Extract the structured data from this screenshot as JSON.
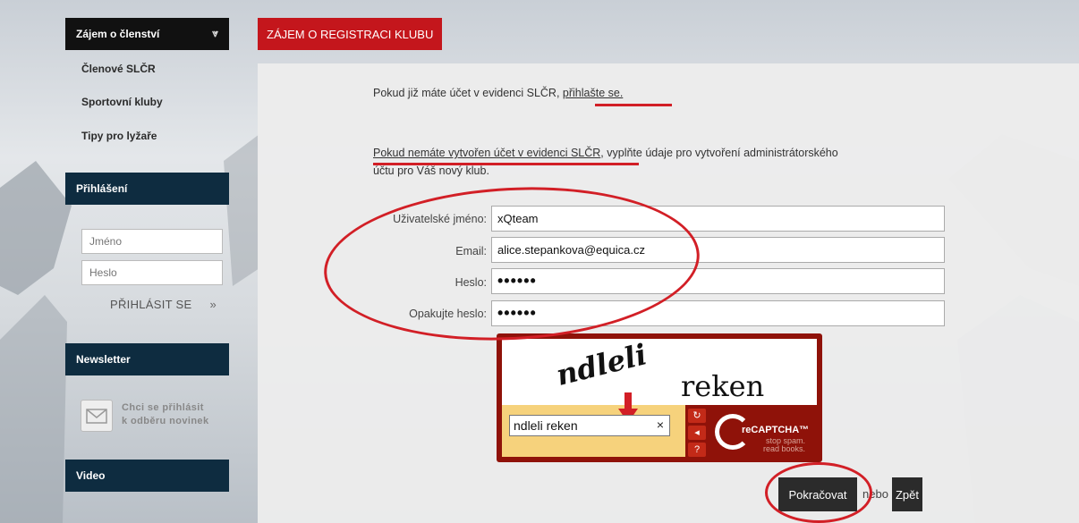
{
  "sidebar": {
    "top_header": "Zájem o členství",
    "links": [
      "Členové SLČR",
      "Sportovní kluby",
      "Tipy pro lyžaře"
    ],
    "login_header": "Přihlášení",
    "login_name_placeholder": "Jméno",
    "login_password_placeholder": "Heslo",
    "login_button": "PŘIHLÁSIT SE",
    "newsletter_header": "Newsletter",
    "newsletter_text_line1": "Chci se přihlásit",
    "newsletter_text_line2": "k odběru novinek",
    "video_header": "Video"
  },
  "main": {
    "tab_title": "ZÁJEM O REGISTRACI KLUBU",
    "intro_text": "Pokud již máte účet v evidenci SLČR, ",
    "intro_link": "přihlašte se.",
    "new_account_link": "Pokud nemáte vytvořen účet v evidenci SLČR",
    "new_account_text_rest": ", vyplňte údaje pro vytvoření administrátorského",
    "new_account_text_line2": "účtu pro Váš nový klub.",
    "form": {
      "username_label": "Uživatelské jméno:",
      "username_value": "xQteam",
      "email_label": "Email:",
      "email_value": "alice.stepankova@equica.cz",
      "password_label": "Heslo:",
      "password_value": "••••••",
      "repeat_label": "Opakujte heslo:",
      "repeat_value": "••••••"
    },
    "captcha": {
      "word1": "ndleli",
      "word2": "reken",
      "input_value": "ndleli reken",
      "clear_symbol": "×",
      "brand": "reCAPTCHA™",
      "tagline1": "stop spam.",
      "tagline2": "read books."
    },
    "continue_button": "Pokračovat",
    "or_text": "nebo",
    "back_button": "Zpět"
  },
  "colors": {
    "accent_red": "#c4161c",
    "sidebar_header": "#0e2c40",
    "annotation": "#d21f26"
  }
}
